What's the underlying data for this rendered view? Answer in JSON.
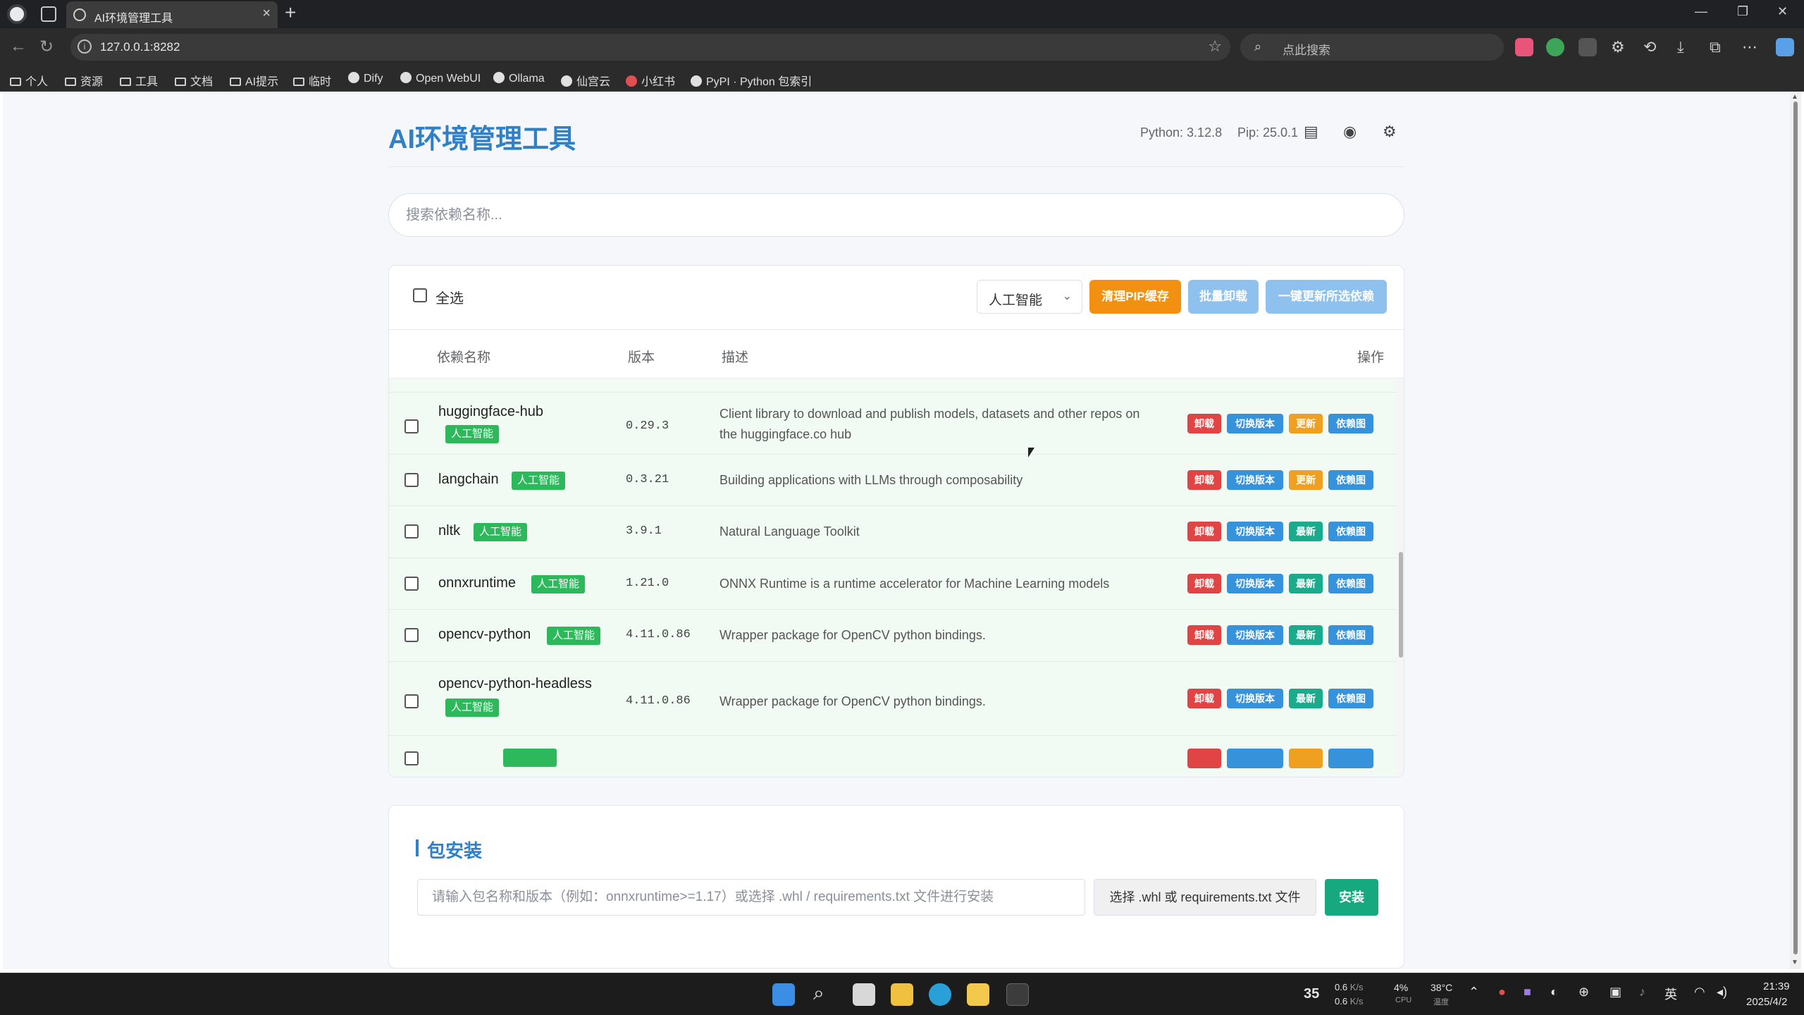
{
  "browser": {
    "tab_title": "AI环境管理工具",
    "url": "127.0.0.1:8282",
    "search_placeholder": "点此搜索",
    "bookmarks": [
      "个人",
      "资源",
      "工具",
      "文档",
      "AI提示",
      "临时",
      "Dify",
      "Open WebUI",
      "Ollama",
      "仙宫云",
      "小红书",
      "PyPI · Python 包索引"
    ]
  },
  "header": {
    "title": "AI环境管理工具",
    "python_version": "Python: 3.12.8",
    "pip_version": "Pip: 25.0.1"
  },
  "search": {
    "placeholder": "搜索依赖名称..."
  },
  "toolbar": {
    "select_all": "全选",
    "category": "人工智能",
    "clear_cache": "清理PIP缓存",
    "batch_uninstall": "批量卸载",
    "update_selected": "一键更新所选依赖"
  },
  "table": {
    "columns": {
      "name": "依赖名称",
      "version": "版本",
      "description": "描述",
      "actions": "操作"
    },
    "action_labels": {
      "uninstall": "卸载",
      "switch": "切换版本",
      "update": "更新",
      "latest": "最新",
      "deps": "依赖图"
    },
    "rows": [
      {
        "name": "huggingface-hub",
        "tag": "人工智能",
        "version": "0.29.3",
        "description": "Client library to download and publish models, datasets and other repos on the huggingface.co hub",
        "status": "更新"
      },
      {
        "name": "langchain",
        "tag": "人工智能",
        "version": "0.3.21",
        "description": "Building applications with LLMs through composability",
        "status": "更新"
      },
      {
        "name": "nltk",
        "tag": "人工智能",
        "version": "3.9.1",
        "description": "Natural Language Toolkit",
        "status": "最新"
      },
      {
        "name": "onnxruntime",
        "tag": "人工智能",
        "version": "1.21.0",
        "description": "ONNX Runtime is a runtime accelerator for Machine Learning models",
        "status": "最新"
      },
      {
        "name": "opencv-python",
        "tag": "人工智能",
        "version": "4.11.0.86",
        "description": "Wrapper package for OpenCV python bindings.",
        "status": "最新"
      },
      {
        "name": "opencv-python-headless",
        "tag": "人工智能",
        "version": "4.11.0.86",
        "description": "Wrapper package for OpenCV python bindings.",
        "status": "最新"
      }
    ]
  },
  "install": {
    "title": "包安装",
    "placeholder": "请输入包名称和版本（例如：onnxruntime>=1.17）或选择 .whl / requirements.txt 文件进行安装",
    "file_button": "选择 .whl 或 requirements.txt 文件",
    "install_button": "安装"
  },
  "taskbar": {
    "badge": "35",
    "net_up": "0.6",
    "net_down": "0.6",
    "net_unit": "K/s",
    "cpu_value": "4%",
    "cpu_label": "CPU",
    "temp_value": "38°C",
    "temp_label": "温度",
    "ime": "英",
    "time": "21:39",
    "date": "2025/4/2"
  }
}
